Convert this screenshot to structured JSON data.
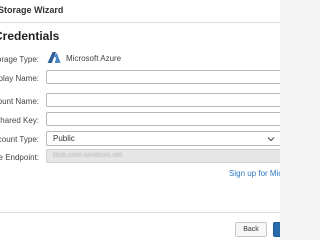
{
  "window": {
    "title": "Storage Wizard"
  },
  "section": {
    "heading": "Credentials"
  },
  "form": {
    "storage_type": {
      "label": "Storage Type:",
      "value": "Microsoft Azure",
      "icon": "azure-logo-icon",
      "icon_color": "#3b6ea5"
    },
    "display_name": {
      "label": "Display Name:",
      "value": ""
    },
    "account_name": {
      "label": "Account Name:",
      "value": ""
    },
    "shared_key": {
      "label": "Shared Key:",
      "value": ""
    },
    "account_type": {
      "label": "Account Type:",
      "value": "Public"
    },
    "service_endpoint": {
      "label": "Service Endpoint:",
      "value": "blob.core.windows.net"
    }
  },
  "signup": {
    "link_text": "Sign up for Micros"
  },
  "footer": {
    "back_label": "Back",
    "next_label": ""
  },
  "colors": {
    "link": "#2b78c2",
    "primary_button": "#2a6bab"
  }
}
